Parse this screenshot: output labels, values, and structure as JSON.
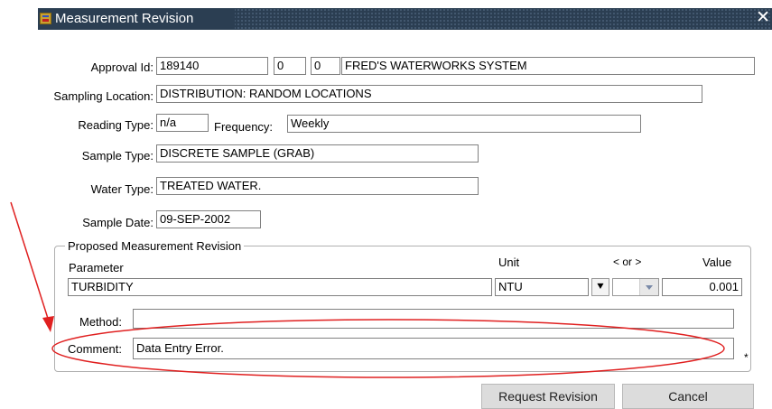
{
  "window": {
    "title": "Measurement Revision",
    "close_glyph": "✕"
  },
  "form": {
    "approval_id_label": "Approval Id:",
    "approval_id": "189140",
    "approval_sub1": "0",
    "approval_sub2": "0",
    "system_name": "FRED'S WATERWORKS SYSTEM",
    "sampling_location_label": "Sampling Location:",
    "sampling_location": "DISTRIBUTION: RANDOM LOCATIONS",
    "reading_type_label": "Reading Type:",
    "reading_type": "n/a",
    "frequency_label": "Frequency:",
    "frequency": "Weekly",
    "sample_type_label": "Sample Type:",
    "sample_type": "DISCRETE SAMPLE (GRAB)",
    "water_type_label": "Water Type:",
    "water_type": "TREATED WATER.",
    "sample_date_label": "Sample Date:",
    "sample_date": "09-SEP-2002"
  },
  "revision": {
    "group_title": "Proposed Measurement Revision",
    "parameter_header": "Parameter",
    "unit_header": "Unit",
    "comparator_header": "< or >",
    "value_header": "Value",
    "parameter": "TURBIDITY",
    "unit": "NTU",
    "comparator": "",
    "value": "0.001",
    "method_label": "Method:",
    "method": "",
    "comment_label": "Comment:",
    "comment": "Data Entry Error.",
    "required_marker": "*"
  },
  "buttons": {
    "request": "Request Revision",
    "cancel": "Cancel"
  },
  "icons": {
    "download": "download-arrow-icon",
    "app": "app-window-icon"
  },
  "colors": {
    "titlebar": "#2b3e52",
    "annotation": "#e02020"
  }
}
